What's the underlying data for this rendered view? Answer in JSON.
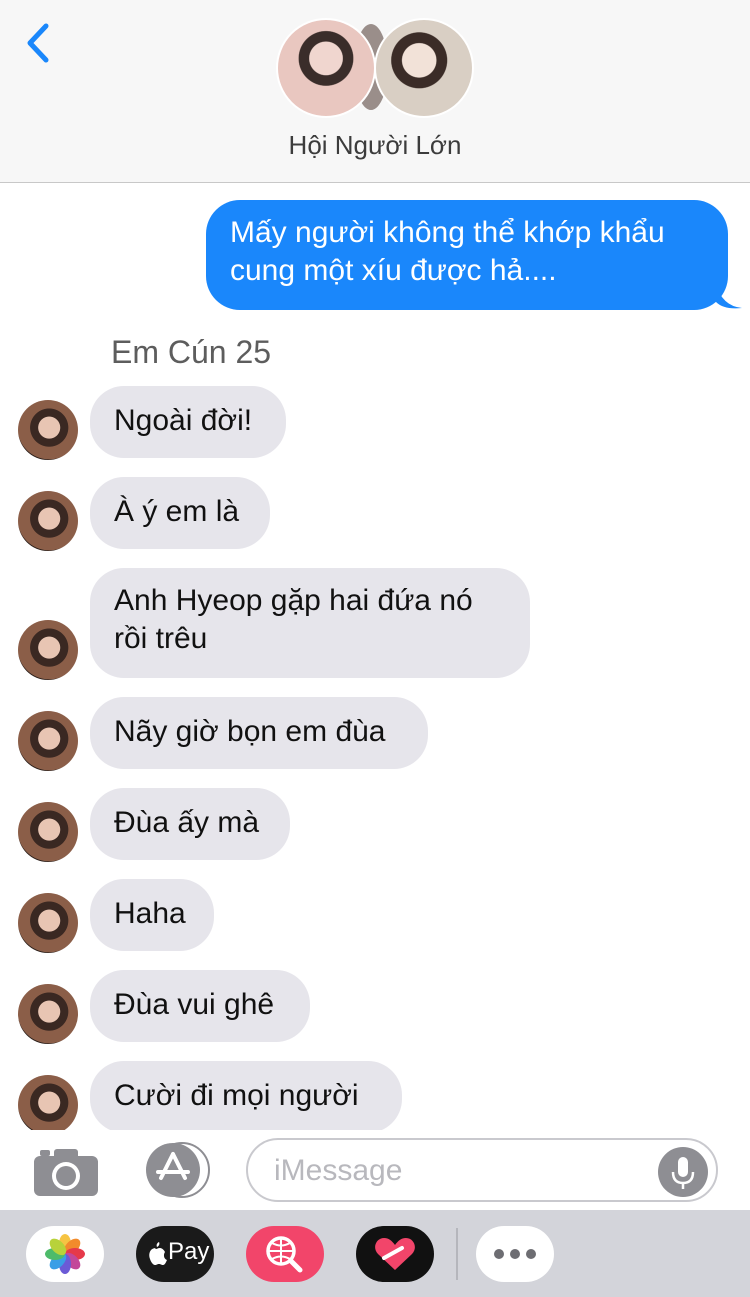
{
  "header": {
    "title": "Hội Người Lớn",
    "back_icon": "chevron-left-icon"
  },
  "messages": {
    "outgoing": {
      "text": "Mấy người không thể khớp khẩu cung một xíu được hả...."
    },
    "sender_name": "Em Cún 25",
    "incoming": [
      "Ngoài đời!",
      "À ý em là",
      "Anh Hyeop gặp hai đứa nó rồi trêu",
      "Nãy giờ bọn em đùa",
      "Đùa ấy mà",
      "Haha",
      "Đùa vui ghê",
      "Cười đi mọi người"
    ]
  },
  "composer": {
    "placeholder": "iMessage",
    "camera_icon": "camera-icon",
    "apps_icon": "app-store-icon",
    "mic_icon": "microphone-icon"
  },
  "app_drawer": {
    "applepay_label": "Pay",
    "items": [
      "photos-icon",
      "apple-pay-icon",
      "web-search-icon",
      "digital-touch-icon",
      "more-icon"
    ]
  },
  "colors": {
    "outgoing_bubble": "#1a87fb",
    "incoming_bubble": "#e6e5eb",
    "accent": "#1a87fb"
  }
}
